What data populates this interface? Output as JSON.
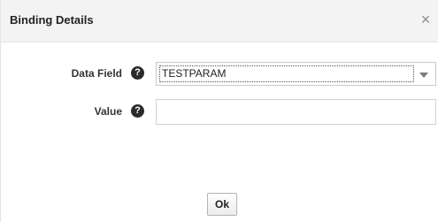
{
  "dialog": {
    "title": "Binding Details",
    "close_glyph": "×",
    "close_icon": "close-icon"
  },
  "form": {
    "data_field": {
      "label": "Data Field",
      "help_glyph": "?",
      "help_icon": "question-icon",
      "selected_value": "TESTPARAM",
      "dropdown_icon": "chevron-down-icon"
    },
    "value": {
      "label": "Value",
      "help_glyph": "?",
      "help_icon": "question-icon",
      "current_value": "",
      "placeholder": ""
    }
  },
  "buttons": {
    "ok_label": "Ok"
  }
}
